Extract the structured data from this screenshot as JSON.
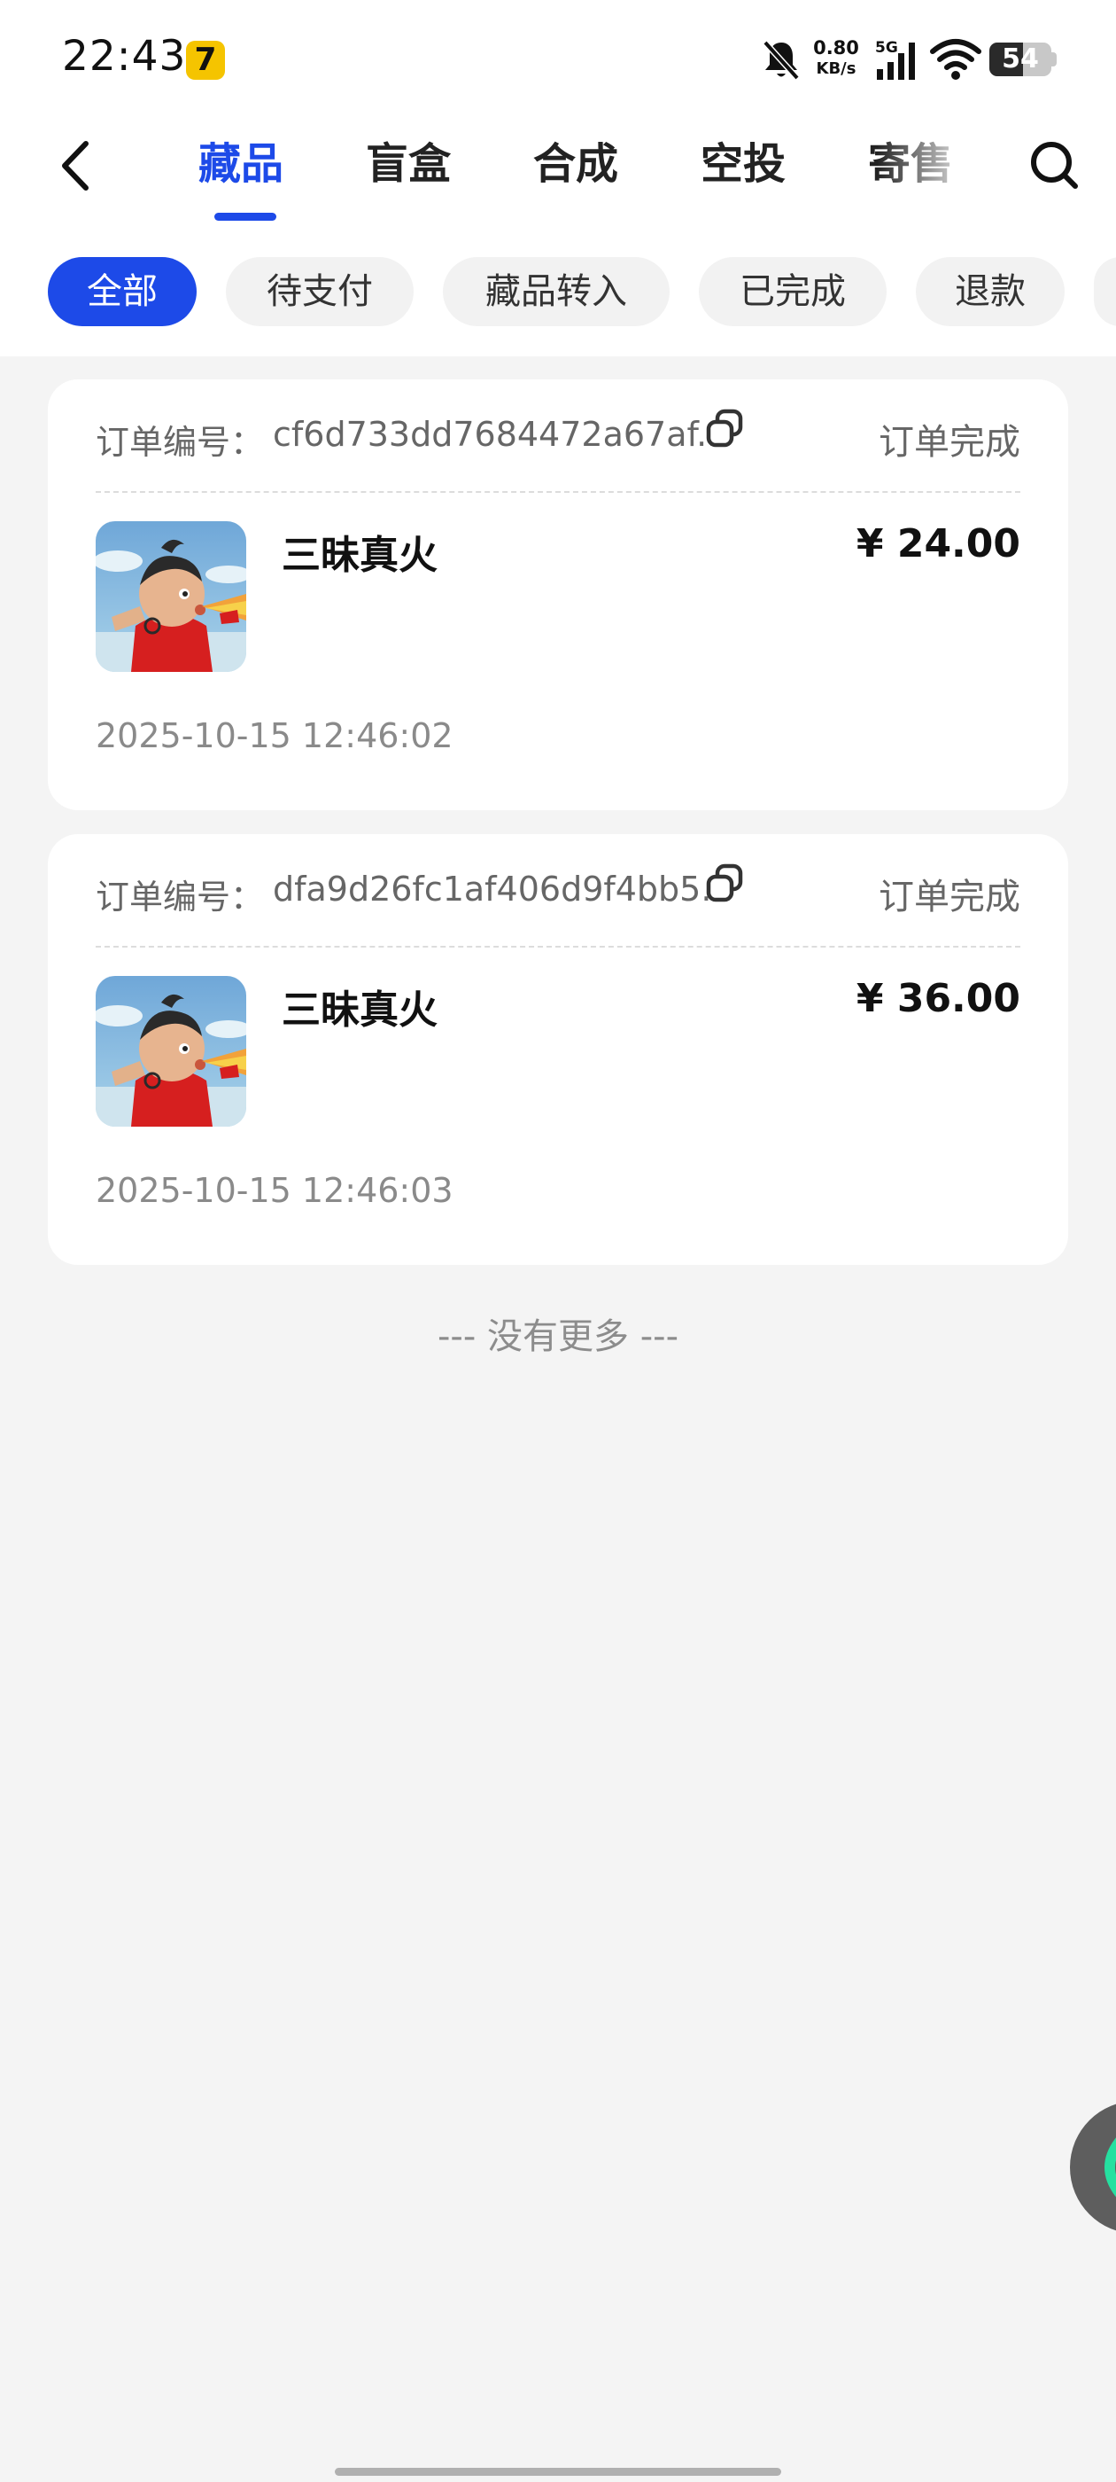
{
  "status_bar": {
    "time": "22:43",
    "app_icon_glyph": "7",
    "net_speed_value": "0.80",
    "net_speed_unit": "KB/s",
    "signal_label": "5G",
    "battery_level": "54"
  },
  "nav": {
    "tabs": [
      {
        "label": "藏品",
        "active": true
      },
      {
        "label": "盲盒",
        "active": false
      },
      {
        "label": "合成",
        "active": false
      },
      {
        "label": "空投",
        "active": false
      },
      {
        "label": "寄售",
        "active": false
      }
    ]
  },
  "filters": [
    {
      "label": "全部",
      "active": true
    },
    {
      "label": "待支付",
      "active": false
    },
    {
      "label": "藏品转入",
      "active": false
    },
    {
      "label": "已完成",
      "active": false
    },
    {
      "label": "退款",
      "active": false
    }
  ],
  "orders": [
    {
      "order_label": "订单编号：",
      "order_id": "cf6d733dd7684472a67af...",
      "status": "订单完成",
      "item_name": "三昧真火",
      "price": "¥ 24.00",
      "time": "2025-10-15 12:46:02"
    },
    {
      "order_label": "订单编号：",
      "order_id": "dfa9d26fc1af406d9f4bb5...",
      "status": "订单完成",
      "item_name": "三昧真火",
      "price": "¥ 36.00",
      "time": "2025-10-15 12:46:03"
    }
  ],
  "footer": {
    "no_more": "--- 没有更多 ---"
  },
  "colors": {
    "accent": "#1d4ae8",
    "background": "#f4f4f4",
    "card": "#ffffff"
  },
  "icons": [
    "back-arrow-icon",
    "search-icon",
    "copy-icon",
    "bell-muted-icon",
    "signal-icon",
    "wifi-icon",
    "battery-icon"
  ]
}
